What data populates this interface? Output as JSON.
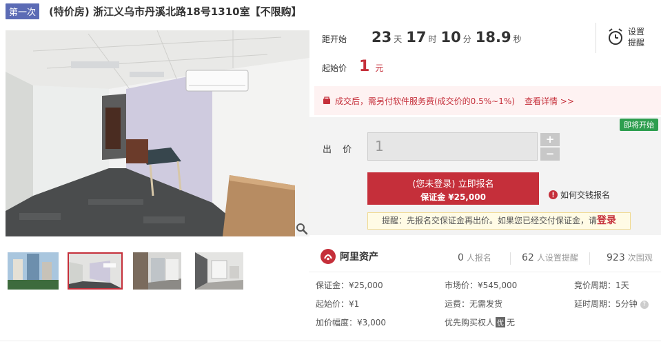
{
  "header": {
    "round": "第一次",
    "title": "(特价房) 浙江义乌市丹溪北路18号1310室【不限购】"
  },
  "countdown": {
    "label": "距开始",
    "days": "23",
    "days_unit": "天",
    "hours": "17",
    "hours_unit": "时",
    "minutes": "10",
    "minutes_unit": "分",
    "seconds": "18.9",
    "seconds_unit": "秒"
  },
  "remind": {
    "line1": "设置",
    "line2": "提醒"
  },
  "start_price": {
    "label": "起始价",
    "value": "1",
    "unit": "元"
  },
  "fee_notice": {
    "text": "成交后，需另付软件服务费(成交价的0.5%~1%)",
    "link": "查看详情 >>"
  },
  "bid": {
    "status_badge": "即将开始",
    "label": "出 价",
    "input_value": "1",
    "plus": "+",
    "minus": "−",
    "signup_main": "(您未登录) 立即报名",
    "signup_sub": "保证金 ¥25,000",
    "howto": "如何交钱报名",
    "tip_text": "提醒：先报名交保证金再出价。如果您已经交付保证金，请",
    "tip_login": "登录"
  },
  "brand": {
    "name": "阿里资产"
  },
  "stats": [
    {
      "value": "0",
      "unit": "人报名"
    },
    {
      "value": "62",
      "unit": "人设置提醒"
    },
    {
      "value": "923",
      "unit": "次围观"
    }
  ],
  "details": {
    "deposit": "保证金：¥25,000",
    "market_price": "市场价：¥545,000",
    "bid_cycle": "竞价周期：1天",
    "start_price": "起始价：¥1",
    "shipping": "运费：无需发货",
    "delay_cycle": "延时周期：5分钟",
    "increment": "加价幅度：¥3,000",
    "priority_label": "优先购买权人",
    "priority_badge": "优",
    "priority_value": "无"
  },
  "colors": {
    "accent_red": "#c52f3a",
    "round_badge": "#5b6bb5",
    "status_green": "#2e9e4f"
  }
}
